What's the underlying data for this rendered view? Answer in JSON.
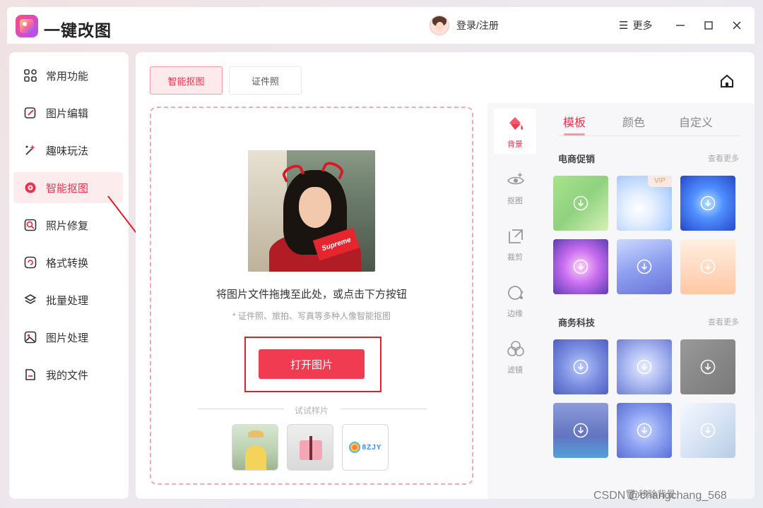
{
  "app": {
    "title": "一键改图"
  },
  "header": {
    "login_label": "登录/注册",
    "more_label": "更多"
  },
  "sidebar": {
    "items": [
      {
        "label": "常用功能",
        "icon": "grid-icon"
      },
      {
        "label": "图片编辑",
        "icon": "edit-icon"
      },
      {
        "label": "趣味玩法",
        "icon": "magic-wand-icon"
      },
      {
        "label": "智能抠图",
        "icon": "target-icon",
        "active": true
      },
      {
        "label": "照片修复",
        "icon": "repair-icon"
      },
      {
        "label": "格式转换",
        "icon": "convert-icon"
      },
      {
        "label": "批量处理",
        "icon": "layers-icon"
      },
      {
        "label": "图片处理",
        "icon": "image-icon"
      },
      {
        "label": "我的文件",
        "icon": "file-icon"
      }
    ]
  },
  "tabs": [
    {
      "label": "智能抠图",
      "active": true
    },
    {
      "label": "证件照",
      "active": false
    }
  ],
  "dropzone": {
    "photo_text": "Supreme",
    "hint": "将图片文件拖拽至此处，或点击下方按钮",
    "sub_hint": "* 证件照、旅拍、写真等多种人像智能抠图",
    "open_button": "打开图片",
    "samples_label": "试试样片",
    "sample3_brand": "8ZJY"
  },
  "rail": {
    "items": [
      {
        "label": "背景",
        "icon": "paint-bucket-icon",
        "active": true
      },
      {
        "label": "抠图",
        "icon": "eye-sparkle-icon"
      },
      {
        "label": "裁剪",
        "icon": "crop-icon"
      },
      {
        "label": "边缘",
        "icon": "edge-icon"
      },
      {
        "label": "滤镜",
        "icon": "filter-icon"
      }
    ]
  },
  "panel": {
    "tabs": [
      {
        "label": "模板",
        "active": true
      },
      {
        "label": "颜色"
      },
      {
        "label": "自定义"
      }
    ],
    "sections": [
      {
        "title": "电商促销",
        "more": "查看更多"
      },
      {
        "title": "商务科技",
        "more": "查看更多"
      }
    ],
    "vip_label": "VIP",
    "remove_bg": "移除背景"
  },
  "watermark": "CSDN @changchang_568",
  "colors": {
    "accent": "#f13b50",
    "annotation": "#e31e24"
  }
}
